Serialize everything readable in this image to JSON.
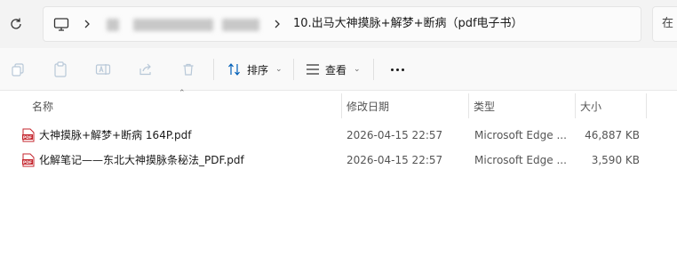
{
  "address_bar": {
    "current_folder": "10.出马大神摸脉+解梦+断病（pdf电子书）",
    "search_placeholder": "在"
  },
  "toolbar": {
    "sort_label": "排序",
    "view_label": "查看"
  },
  "columns": {
    "name": "名称",
    "modified": "修改日期",
    "type": "类型",
    "size": "大小"
  },
  "files": [
    {
      "name": "大神摸脉+解梦+断病 164P.pdf",
      "modified": "2026-04-15 22:57",
      "type": "Microsoft Edge ...",
      "size": "46,887 KB"
    },
    {
      "name": "化解笔记——东北大神摸脉条秘法_PDF.pdf",
      "modified": "2026-04-15 22:57",
      "type": "Microsoft Edge ...",
      "size": "3,590 KB"
    }
  ],
  "colors": {
    "pdf_icon": "#c4262e",
    "accent": "#005fb8"
  }
}
